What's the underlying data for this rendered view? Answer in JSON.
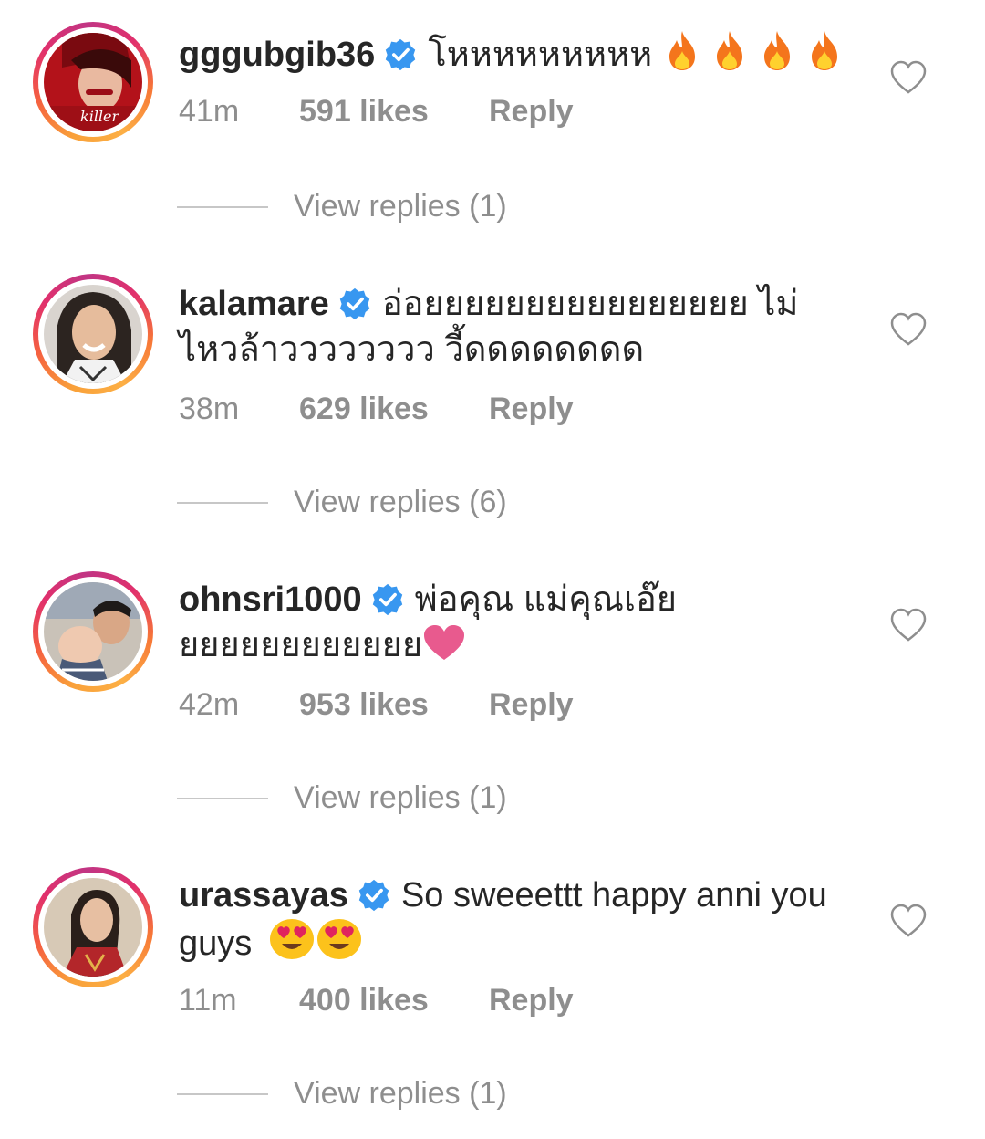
{
  "comments": [
    {
      "username": "gggubgib36",
      "verified": true,
      "text": "โหหหหหหหหห",
      "trailing_emoji": [
        "fire-icon",
        "fire-icon",
        "fire-icon",
        "fire-icon"
      ],
      "time": "41m",
      "likes": "591 likes",
      "reply_label": "Reply",
      "view_replies": "View replies (1)",
      "avatar_caption": "killer"
    },
    {
      "username": "kalamare",
      "verified": true,
      "text": "อ่อยยยยยยยยยยยยยยยย ไม่ไหวล้าวววววววว วี้ดดดดดดดด",
      "trailing_emoji": [],
      "time": "38m",
      "likes": "629 likes",
      "reply_label": "Reply",
      "view_replies": "View replies (6)"
    },
    {
      "username": "ohnsri1000",
      "verified": true,
      "text": "พ่อคุณ แม่คุณเอ๊ยยยยยยยยยยยยย",
      "trailing_emoji": [
        "heart-emoji"
      ],
      "time": "42m",
      "likes": "953 likes",
      "reply_label": "Reply",
      "view_replies": "View replies (1)"
    },
    {
      "username": "urassayas",
      "verified": true,
      "text": "So sweeettt happy anni you guys",
      "trailing_emoji": [
        "heart-eyes-emoji",
        "heart-eyes-emoji"
      ],
      "time": "11m",
      "likes": "400 likes",
      "reply_label": "Reply",
      "view_replies": "View replies (1)"
    }
  ],
  "colors": {
    "text": "#262626",
    "secondary": "#8e8e8e",
    "verified_blue": "#3897f0",
    "divider": "#c7c7c7"
  }
}
